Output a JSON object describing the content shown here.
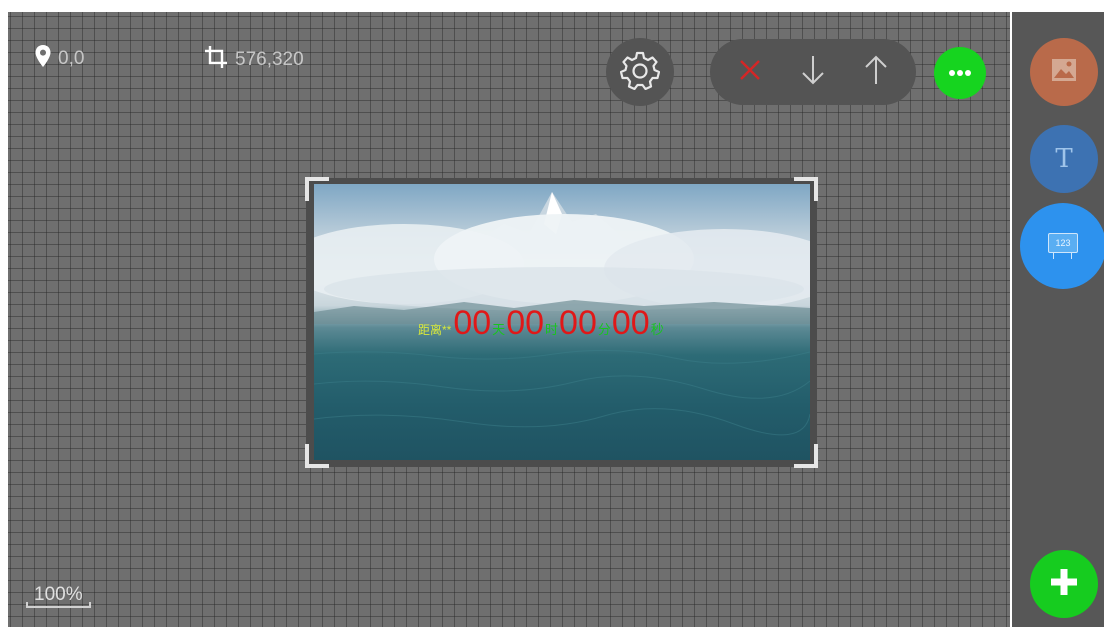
{
  "readouts": {
    "position": "0,0",
    "size": "576,320"
  },
  "countdown": {
    "label": "距离**",
    "segments": [
      {
        "value": "00",
        "unit": "天"
      },
      {
        "value": "00",
        "unit": "时"
      },
      {
        "value": "00",
        "unit": "分"
      },
      {
        "value": "00",
        "unit": "秒"
      }
    ]
  },
  "sidebar": {
    "text_button_glyph": "T",
    "counter_button_badge": "123"
  },
  "zoom_level": "100%",
  "icons": {
    "position": "map-pin-icon",
    "size": "crop-icon",
    "settings": "gear-icon",
    "delete": "close-icon",
    "move_down": "arrow-down-icon",
    "move_up": "arrow-up-icon",
    "more": "more-dots-icon",
    "add_image": "image-icon",
    "add_text": "text-icon",
    "add_counter": "counter-icon",
    "add": "plus-icon"
  },
  "colors": {
    "delete_icon": "#d42626",
    "more_button": "#16d41f",
    "image_button": "#b96a4a",
    "text_button": "#3d72b2",
    "counter_button": "#2d92ee",
    "add_button": "#16cc1f",
    "countdown_digits": "#e01818",
    "countdown_units": "#19c41f",
    "countdown_label": "#d9e83a"
  }
}
